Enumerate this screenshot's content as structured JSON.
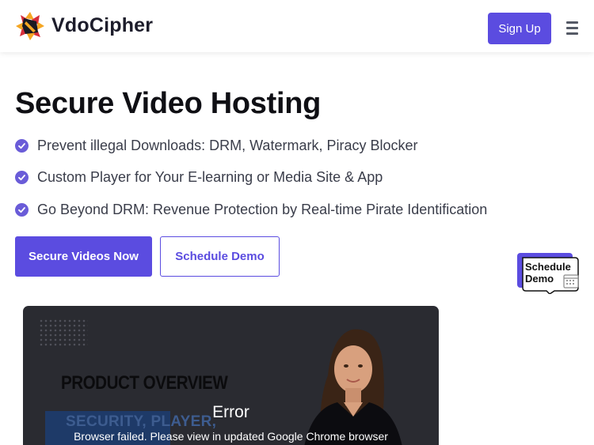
{
  "header": {
    "brand": "VdoCipher",
    "signup_label": "Sign Up"
  },
  "hero": {
    "title": "Secure Video Hosting",
    "features": [
      "Prevent illegal Downloads: DRM, Watermark, Piracy Blocker",
      "Custom Player for Your E-learning or Media Site & App",
      "Go Beyond DRM: Revenue Protection by Real-time Pirate Identification"
    ],
    "primary_cta": "Secure Videos Now",
    "secondary_cta": "Schedule Demo"
  },
  "floating_demo": {
    "line1": "Schedule",
    "line2": "Demo",
    "icon": "calendar-icon"
  },
  "video": {
    "overlay_heading": "PRODUCT OVERVIEW",
    "overlay_subheading": "SECURITY, PLAYER,",
    "error_title": "Error",
    "error_message": "Browser failed. Please view in updated Google Chrome browser"
  },
  "colors": {
    "accent": "#5b4ce0",
    "check": "#6a5cd8",
    "video_bg": "#2a2b31"
  }
}
